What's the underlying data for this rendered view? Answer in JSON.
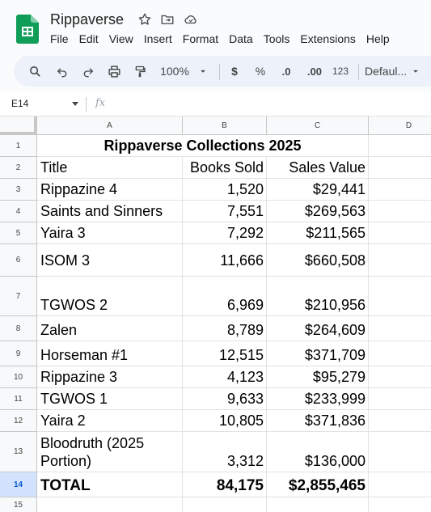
{
  "app": {
    "doc_title": "Rippaverse",
    "menu": [
      "File",
      "Edit",
      "View",
      "Insert",
      "Format",
      "Data",
      "Tools",
      "Extensions",
      "Help"
    ],
    "brand_color": "#0f9d58"
  },
  "toolbar": {
    "zoom": "100%",
    "currency": "$",
    "percent": "%",
    "dec_decrease": ".0",
    "dec_increase": ".00",
    "number_format": "123",
    "font": "Defaul..."
  },
  "formula_bar": {
    "cell_ref": "E14",
    "fx": "fx",
    "content": ""
  },
  "grid": {
    "columns": [
      "A",
      "B",
      "C",
      "D"
    ],
    "rows": [
      "1",
      "2",
      "3",
      "4",
      "5",
      "6",
      "7",
      "8",
      "9",
      "10",
      "11",
      "12",
      "13",
      "14",
      "15"
    ],
    "active_row": "14",
    "title": "Rippaverse Collections 2025",
    "headers": [
      "Title",
      "Books Sold",
      "Sales Value"
    ],
    "data": [
      [
        "Rippazine 4",
        "1,520",
        "$29,441"
      ],
      [
        "Saints and Sinners",
        "7,551",
        "$269,563"
      ],
      [
        "Yaira 3",
        "7,292",
        "$211,565"
      ],
      [
        "ISOM 3",
        "11,666",
        "$660,508"
      ],
      [
        "TGWOS 2",
        "6,969",
        "$210,956"
      ],
      [
        "Zalen",
        "8,789",
        "$264,609"
      ],
      [
        "Horseman #1",
        "12,515",
        "$371,709"
      ],
      [
        "Rippazine 3",
        "4,123",
        "$95,279"
      ],
      [
        "TGWOS 1",
        "9,633",
        "$233,999"
      ],
      [
        "Yaira 2",
        "10,805",
        "$371,836"
      ],
      [
        "Bloodruth (2025 Portion)",
        "3,312",
        "$136,000"
      ]
    ],
    "total": [
      "TOTAL",
      "84,175",
      "$2,855,465"
    ]
  }
}
